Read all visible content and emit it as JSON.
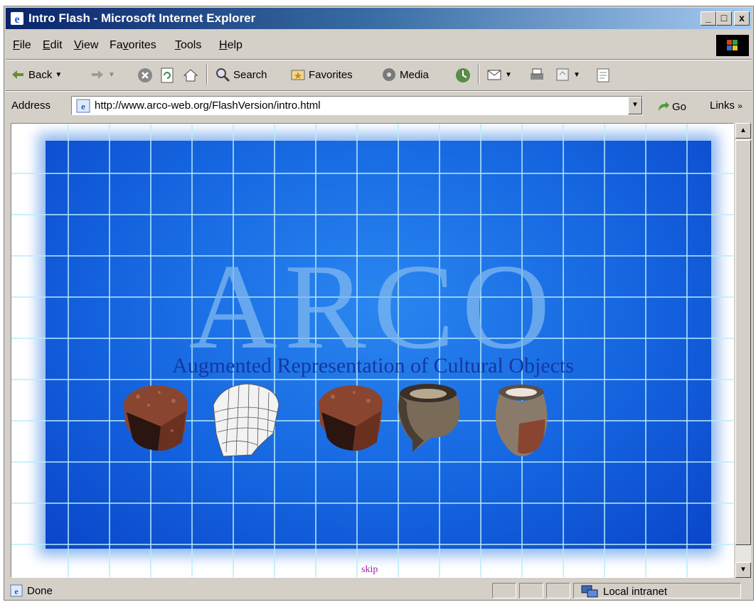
{
  "window": {
    "title": "Intro Flash - Microsoft Internet Explorer",
    "controls": {
      "minimize": "_",
      "maximize": "□",
      "close": "x"
    }
  },
  "menu": [
    {
      "label": "ile",
      "key": "F"
    },
    {
      "label": "dit",
      "key": "E"
    },
    {
      "label": "iew",
      "key": "V"
    },
    {
      "label": "Fa",
      "key": "v",
      "rest": "orites"
    },
    {
      "label": "ools",
      "key": "T"
    },
    {
      "label": "elp",
      "key": "H"
    }
  ],
  "toolbar": {
    "back": "Back",
    "search": "Search",
    "favorites": "Favorites",
    "media": "Media"
  },
  "address": {
    "label": "Address",
    "url": "http://www.arco-web.org/FlashVersion/intro.html",
    "go": "Go",
    "links": "Links"
  },
  "flash": {
    "title": "ARCO",
    "subtitle": "Augmented Representation of Cultural Objects",
    "skip": "skip"
  },
  "status": {
    "text": "Done",
    "zone": "Local intranet"
  },
  "colors": {
    "flash_blue": "#1565e0",
    "title_bar": "#0a246a",
    "chrome": "#d4d0c8"
  }
}
